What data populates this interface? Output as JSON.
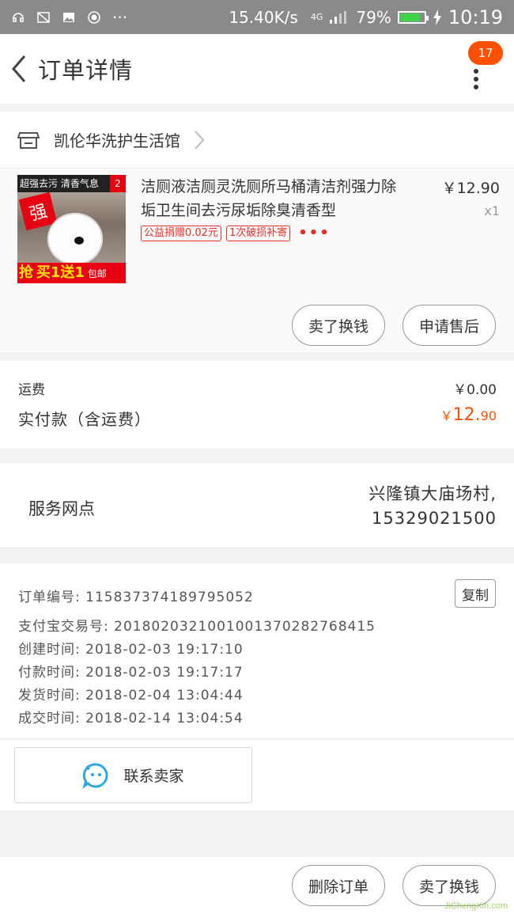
{
  "status_bar": {
    "speed": "15.40K/s",
    "network": "4G",
    "battery": "79%",
    "time": "10:19",
    "more": "···"
  },
  "header": {
    "title": "订单详情",
    "badge_count": "17"
  },
  "shop": {
    "name": "凯伦华洗护生活馆"
  },
  "product": {
    "title": "洁厕液洁厕灵洗厕所马桶清洁剂强力除垢卫生间去污尿垢除臭清香型",
    "price": "￥12.90",
    "qty": "x1",
    "tags": [
      "公益捐赠0.02元",
      "1次破损补寄"
    ],
    "tag_more": "•••",
    "thumb": {
      "top_text": "超强去污 清香气息",
      "top_num": "2",
      "stamp": "强",
      "bottom_prefix": "抢",
      "bottom_main": "买1送1",
      "bottom_suffix": "包邮"
    },
    "buttons": {
      "sell": "卖了换钱",
      "after_sale": "申请售后"
    }
  },
  "totals": {
    "shipping_label": "运费",
    "shipping_value": "￥0.00",
    "paid_label": "实付款（含运费）",
    "paid_currency": "￥",
    "paid_int": "12.",
    "paid_dec": "90"
  },
  "service": {
    "label": "服务网点",
    "address_line1": "兴隆镇大庙场村,",
    "address_line2": "15329021500"
  },
  "order_info": {
    "order_no": "订单编号: 115837374189795052",
    "alipay_no": "支付宝交易号: 2018020321001001370282768415",
    "created": "创建时间: 2018-02-03 19:17:10",
    "paid": "付款时间: 2018-02-03 19:17:17",
    "shipped": "发货时间: 2018-02-04 13:04:44",
    "completed": "成交时间: 2018-02-14 13:04:54",
    "copy_label": "复制"
  },
  "contact": {
    "label": "联系卖家"
  },
  "bottom_bar": {
    "delete_label": "删除订单",
    "sell_label": "卖了换钱"
  },
  "watermark": "JiChengXin.com",
  "colors": {
    "accent": "#ff5000",
    "tag_red": "#e0322b",
    "badge": "#ff5000",
    "chat_blue": "#2aa6e8"
  }
}
